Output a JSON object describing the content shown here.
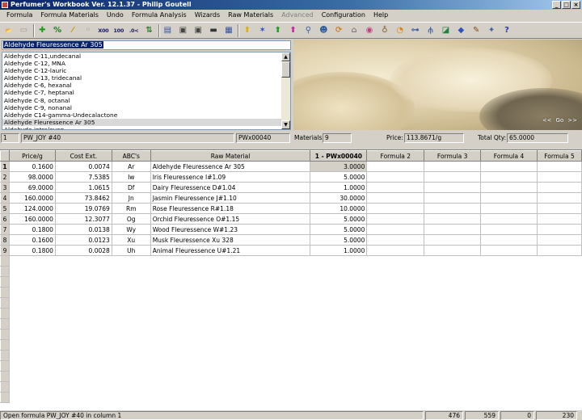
{
  "window": {
    "title": "Perfumer's Workbook Ver. 12.1.37 - Philip Goutell",
    "controls": {
      "minimize": "_",
      "maximize": "□",
      "close": "×"
    }
  },
  "menu": [
    "Formula",
    "Formula Materials",
    "Undo",
    "Formula Analysis",
    "Wizards",
    "Raw Materials",
    "Advanced",
    "Configuration",
    "Help"
  ],
  "toolbar": [
    {
      "icon": "open-folder-icon",
      "glyph": "📂",
      "color": "#c9a227"
    },
    {
      "icon": "new-page-icon",
      "glyph": "▭",
      "color": "#999999"
    },
    {
      "icon": "add-icon",
      "glyph": "✚",
      "color": "#1a9b1a"
    },
    {
      "icon": "percent-icon",
      "glyph": "%",
      "color": "#1a7a1a"
    },
    {
      "icon": "pipette-icon",
      "glyph": "⁄",
      "color": "#d09000"
    },
    {
      "icon": "disabled-icon",
      "glyph": "◦",
      "color": "#a0a0a0"
    },
    {
      "icon": "x00-icon",
      "glyph": "X00",
      "color": "#1a1a6a"
    },
    {
      "icon": "100-icon",
      "glyph": "100",
      "color": "#1a1a6a"
    },
    {
      "icon": "decimal-icon",
      "glyph": ".0<",
      "color": "#1a1a6a"
    },
    {
      "icon": "sort-icon",
      "glyph": "⇅",
      "color": "#2a7a2a"
    },
    {
      "icon": "notepad-icon",
      "glyph": "▤",
      "color": "#3050a0"
    },
    {
      "icon": "save-icon",
      "glyph": "▣",
      "color": "#444444"
    },
    {
      "icon": "save-as-icon",
      "glyph": "▣",
      "color": "#444444"
    },
    {
      "icon": "print-icon",
      "glyph": "▬",
      "color": "#333333"
    },
    {
      "icon": "calculator-icon",
      "glyph": "▦",
      "color": "#3050a0"
    },
    {
      "icon": "arrow-up-yellow-icon",
      "glyph": "⬆",
      "color": "#e0b000"
    },
    {
      "icon": "star-blue-icon",
      "glyph": "✶",
      "color": "#3050c0"
    },
    {
      "icon": "arrow-up-green-icon",
      "glyph": "⬆",
      "color": "#20a020"
    },
    {
      "icon": "arrow-up-magenta-icon",
      "glyph": "⬆",
      "color": "#d020a0"
    },
    {
      "icon": "magnifier-icon",
      "glyph": "⚲",
      "color": "#4060a0"
    },
    {
      "icon": "user-icon",
      "glyph": "☻",
      "color": "#2a5a9a"
    },
    {
      "icon": "refresh-icon",
      "glyph": "⟳",
      "color": "#d08020"
    },
    {
      "icon": "scale-icon",
      "glyph": "⌂",
      "color": "#808080"
    },
    {
      "icon": "palette-icon",
      "glyph": "◉",
      "color": "#c04080"
    },
    {
      "icon": "bottle-icon",
      "glyph": "♁",
      "color": "#806030"
    },
    {
      "icon": "pie-chart-icon",
      "glyph": "◔",
      "color": "#e08000"
    },
    {
      "icon": "flowchart-icon",
      "glyph": "⊶",
      "color": "#4060a0"
    },
    {
      "icon": "tree-icon",
      "glyph": "⫛",
      "color": "#4060a0"
    },
    {
      "icon": "chart-icon",
      "glyph": "◪",
      "color": "#208040"
    },
    {
      "icon": "diamond-icon",
      "glyph": "◆",
      "color": "#3050c0"
    },
    {
      "icon": "pen-icon",
      "glyph": "✎",
      "color": "#8a4a20"
    },
    {
      "icon": "help-contents-icon",
      "glyph": "✦",
      "color": "#4060a0"
    },
    {
      "icon": "help-icon",
      "glyph": "?",
      "color": "#2040c0"
    }
  ],
  "formula_name_input": "Aldehyde Fleuressence Ar 305",
  "material_list": {
    "items": [
      "Aldehyde C-11,undecanal",
      "Aldehyde C-12, MNA",
      "Aldehyde C-12-lauric",
      "Aldehyde C-13, tridecanal",
      "Aldehyde C-6, hexanal",
      "Aldehyde C-7, heptanal",
      "Aldehyde C-8, octanal",
      "Aldehyde C-9, nonanal",
      "Aldehyde C14-gamma-Undecalactone",
      "Aldehyde Fleuressence Ar 305",
      "Aldehyde intraleven"
    ],
    "selected": "Aldehyde Fleuressence Ar 305"
  },
  "photo_nav": {
    "prev": "<<",
    "go": "Go",
    "next": ">>"
  },
  "info": {
    "column_index": "1",
    "formula_name": "PW_JOY #40",
    "formula_code": "PWx00040",
    "materials_label": "Materials:",
    "materials_value": "9",
    "price_label": "Price:",
    "price_value": "113.8671/g",
    "total_label": "Total Qty:",
    "total_value": "65.0000"
  },
  "grid": {
    "columns": [
      "Price/g",
      "Cost Ext.",
      "ABC's",
      "Raw Material",
      "1 - PWx00040",
      "Formula 2",
      "Formula 3",
      "Formula 4",
      "Formula 5"
    ],
    "rows": [
      {
        "n": "1",
        "price": "0.1600",
        "cost": "0.0074",
        "abc": "Ar",
        "material": "Aldehyde Fleuressence Ar 305",
        "qty": "3.0000"
      },
      {
        "n": "2",
        "price": "98.0000",
        "cost": "7.5385",
        "abc": "Iw",
        "material": "Iris Fleuressence I#1.09",
        "qty": "5.0000"
      },
      {
        "n": "3",
        "price": "69.0000",
        "cost": "1.0615",
        "abc": "Df",
        "material": "Dairy Fleuressence D#1.04",
        "qty": "1.0000"
      },
      {
        "n": "4",
        "price": "160.0000",
        "cost": "73.8462",
        "abc": "Jn",
        "material": "Jasmin Fleuressence J#1.10",
        "qty": "30.0000"
      },
      {
        "n": "5",
        "price": "124.0000",
        "cost": "19.0769",
        "abc": "Rm",
        "material": "Rose Fleuressence  R#1.18",
        "qty": "10.0000"
      },
      {
        "n": "6",
        "price": "160.0000",
        "cost": "12.3077",
        "abc": "Og",
        "material": "Orchid Fleuressence O#1.15",
        "qty": "5.0000"
      },
      {
        "n": "7",
        "price": "0.1800",
        "cost": "0.0138",
        "abc": "Wy",
        "material": "Wood Fleuressence W#1.23",
        "qty": "5.0000"
      },
      {
        "n": "8",
        "price": "0.1600",
        "cost": "0.0123",
        "abc": "Xu",
        "material": "Musk Fleuressence Xu 328",
        "qty": "5.0000"
      },
      {
        "n": "9",
        "price": "0.1800",
        "cost": "0.0028",
        "abc": "Uh",
        "material": "Animal Fleuressence U#1.21",
        "qty": "1.0000"
      }
    ]
  },
  "status": {
    "message": "Open formula PW_JOY #40 in column 1",
    "v1": "476",
    "v2": "559",
    "v3": "0",
    "v4": "230"
  }
}
